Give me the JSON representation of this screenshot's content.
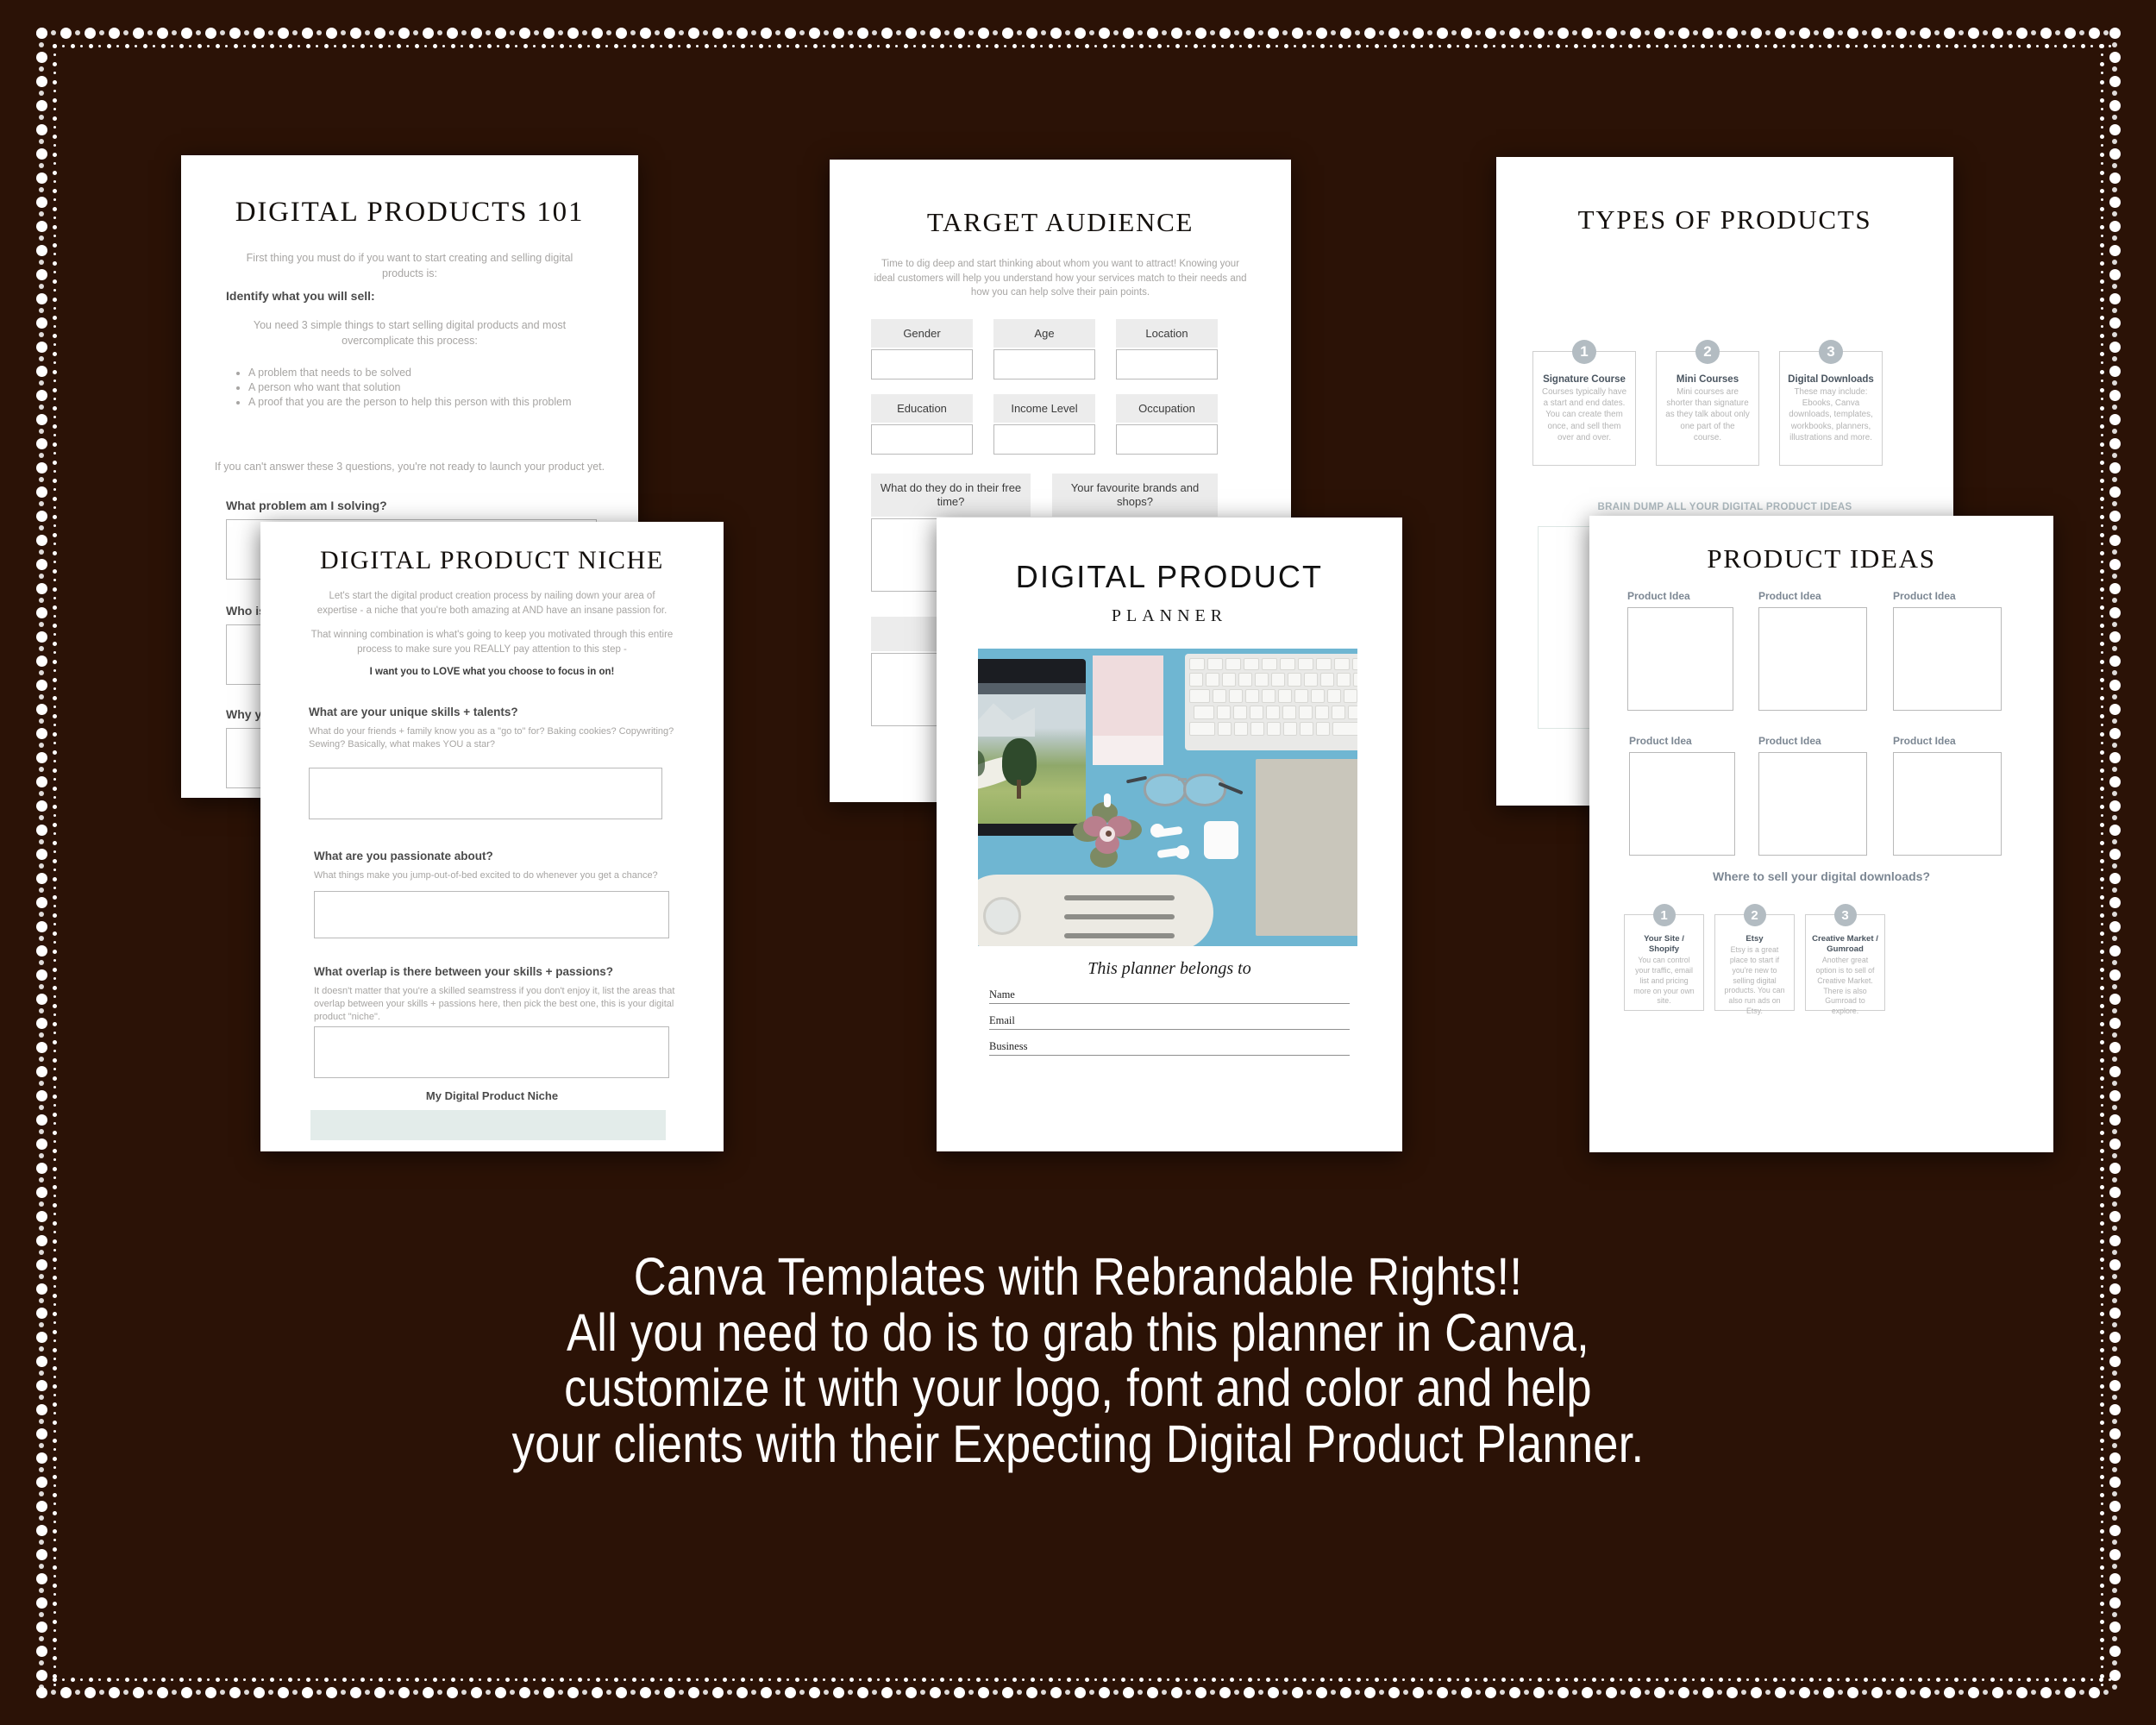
{
  "theme": {
    "background": "#2b1206",
    "sheet": "#ffffff",
    "accent_grey": "#b3bcc2",
    "muted_text": "#a7a5a3",
    "mint_fill": "#e3ecea",
    "photo_blue": "#6fb6d2"
  },
  "sheets": {
    "digital_products_101": {
      "title": "DIGITAL PRODUCTS 101",
      "intro": "First thing you must do if you want to start creating and selling digital products is:",
      "subhead": "Identify what you will sell:",
      "paragraph": "You need 3 simple things to start selling digital products and most overcomplicate this process:",
      "bullets": [
        "A problem that needs to be solved",
        "A person who want that solution",
        "A proof that you are the person to help this person with this problem"
      ],
      "closing": "If you can't answer these 3 questions, you're not ready to launch your product yet.",
      "questions": [
        "What problem am I solving?",
        "Who is",
        "Why y"
      ]
    },
    "target_audience": {
      "title": "TARGET AUDIENCE",
      "intro": "Time to dig deep and start thinking about whom you want to attract! Knowing your ideal customers will help you understand how your services match to their needs and how you can help solve their pain points.",
      "fields_row1": [
        "Gender",
        "Age",
        "Location"
      ],
      "fields_row2": [
        "Education",
        "Income Level",
        "Occupation"
      ],
      "fields_row3": [
        "What do they do in their free time?",
        "Your favourite brands and shops?"
      ]
    },
    "types_of_products": {
      "title": "TYPES OF PRODUCTS",
      "cards": [
        {
          "number": "1",
          "title": "Signature Course",
          "body": "Courses typically have a start and end dates. You can create them once, and sell them over and over."
        },
        {
          "number": "2",
          "title": "Mini Courses",
          "body": "Mini courses are shorter than signature as they talk about only one part of the course."
        },
        {
          "number": "3",
          "title": "Digital Downloads",
          "body": "These may include: Ebooks, Canva downloads, templates, workbooks, planners, illustrations and more."
        }
      ],
      "brain_dump_label": "BRAIN DUMP ALL YOUR DIGITAL PRODUCT IDEAS"
    },
    "digital_product_niche": {
      "title": "DIGITAL PRODUCT NICHE",
      "intro1": "Let's start the digital product creation process by nailing down your area of expertise - a niche that you're both amazing at AND have an insane passion for.",
      "intro2": "That winning combination is what's going to keep you motivated through this entire process to make sure you REALLY pay attention to this step -",
      "intro3_bold": "I want you to LOVE what you choose to focus in on!",
      "questions": [
        {
          "heading": "What are your unique skills + talents?",
          "hint": "What do your friends + family know you as a \"go to\" for? Baking cookies? Copywriting? Sewing? Basically, what makes YOU a star?"
        },
        {
          "heading": "What are you passionate about?",
          "hint": "What things make you jump-out-of-bed excited to do whenever you get a chance?"
        },
        {
          "heading": "What overlap is there between your skills + passions?",
          "hint": "It doesn't matter that you're a skilled seamstress if you don't enjoy it, list the areas that overlap between your skills + passions here, then pick the best one, this is your digital product \"niche\"."
        }
      ],
      "footer_label": "My Digital Product Niche"
    },
    "planner_cover": {
      "title": "DIGITAL PRODUCT",
      "subtitle": "PLANNER",
      "belongs_to": "This planner belongs to",
      "lines": [
        "Name",
        "Email",
        "Business"
      ]
    },
    "product_ideas": {
      "title": "PRODUCT IDEAS",
      "idea_label": "Product Idea",
      "idea_count": 6,
      "where_heading": "Where to sell your digital downloads?",
      "where_cards": [
        {
          "number": "1",
          "title": "Your Site / Shopify",
          "body": "You can control your traffic, email list and pricing more on your own site."
        },
        {
          "number": "2",
          "title": "Etsy",
          "body": "Etsy is a great place to start if you're new to selling digital products. You can also run ads on Etsy."
        },
        {
          "number": "3",
          "title": "Creative Market / Gumroad",
          "body": "Another great option is to sell of Creative Market. There is also Gumroad to explore."
        }
      ]
    }
  },
  "caption": {
    "line1": "Canva Templates with Rebrandable Rights!!",
    "line2": "All you need to do is to grab this planner in Canva,",
    "line3": "customize it with your logo, font and color and help",
    "line4": "your clients with their Expecting Digital Product Planner."
  }
}
